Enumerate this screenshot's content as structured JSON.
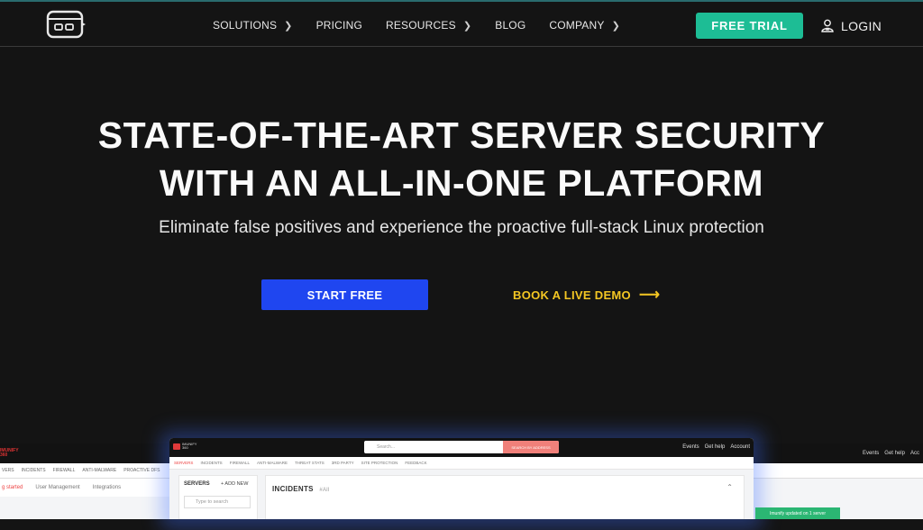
{
  "nav": {
    "items": [
      {
        "label": "SOLUTIONS",
        "chevron": true
      },
      {
        "label": "PRICING",
        "chevron": false
      },
      {
        "label": "RESOURCES",
        "chevron": true
      },
      {
        "label": "BLOG",
        "chevron": false
      },
      {
        "label": "COMPANY",
        "chevron": true
      }
    ],
    "trial_label": "FREE TRIAL",
    "login_label": "LOGIN",
    "colors": {
      "trial": "#1dbd95",
      "accent_line": "#2a6b6e"
    }
  },
  "hero": {
    "title_line1": "STATE-OF-THE-ART SERVER SECURITY",
    "title_line2": "WITH AN ALL-IN-ONE PLATFORM",
    "subtitle": "Eliminate false positives and experience the proactive full-stack Linux protection",
    "start_label": "START FREE",
    "demo_label": "BOOK A LIVE DEMO",
    "demo_arrow": "⟶",
    "colors": {
      "start": "#1f46f0",
      "demo": "#f3c623"
    }
  },
  "preview": {
    "left": {
      "tabs": [
        "VERS",
        "INCIDENTS",
        "FIREWALL",
        "ANTI-MALWARE",
        "PROACTIVE DFS"
      ],
      "row": [
        "g started",
        "User Management",
        "Integrations"
      ]
    },
    "right": {
      "links": [
        "Events",
        "Get help",
        "Acc"
      ]
    },
    "main": {
      "search_placeholder": "Search...",
      "search_button": "SEARCH BY ADDRESS",
      "links": [
        "Events",
        "Get help",
        "Account"
      ],
      "tabs": [
        "SERVERS",
        "INCIDENTS",
        "FIREWALL",
        "ANTI-MALWARE",
        "THREAT STATS",
        "3RD PARTY",
        "SITE PROTECTION",
        "FEEDBACK"
      ],
      "servers_heading": "SERVERS",
      "add_new": "+ ADD NEW",
      "server_search_placeholder": "Type to search",
      "incidents_heading": "INCIDENTS",
      "incidents_filter": "#All",
      "toast": "Imunify updated on 1 server"
    }
  }
}
